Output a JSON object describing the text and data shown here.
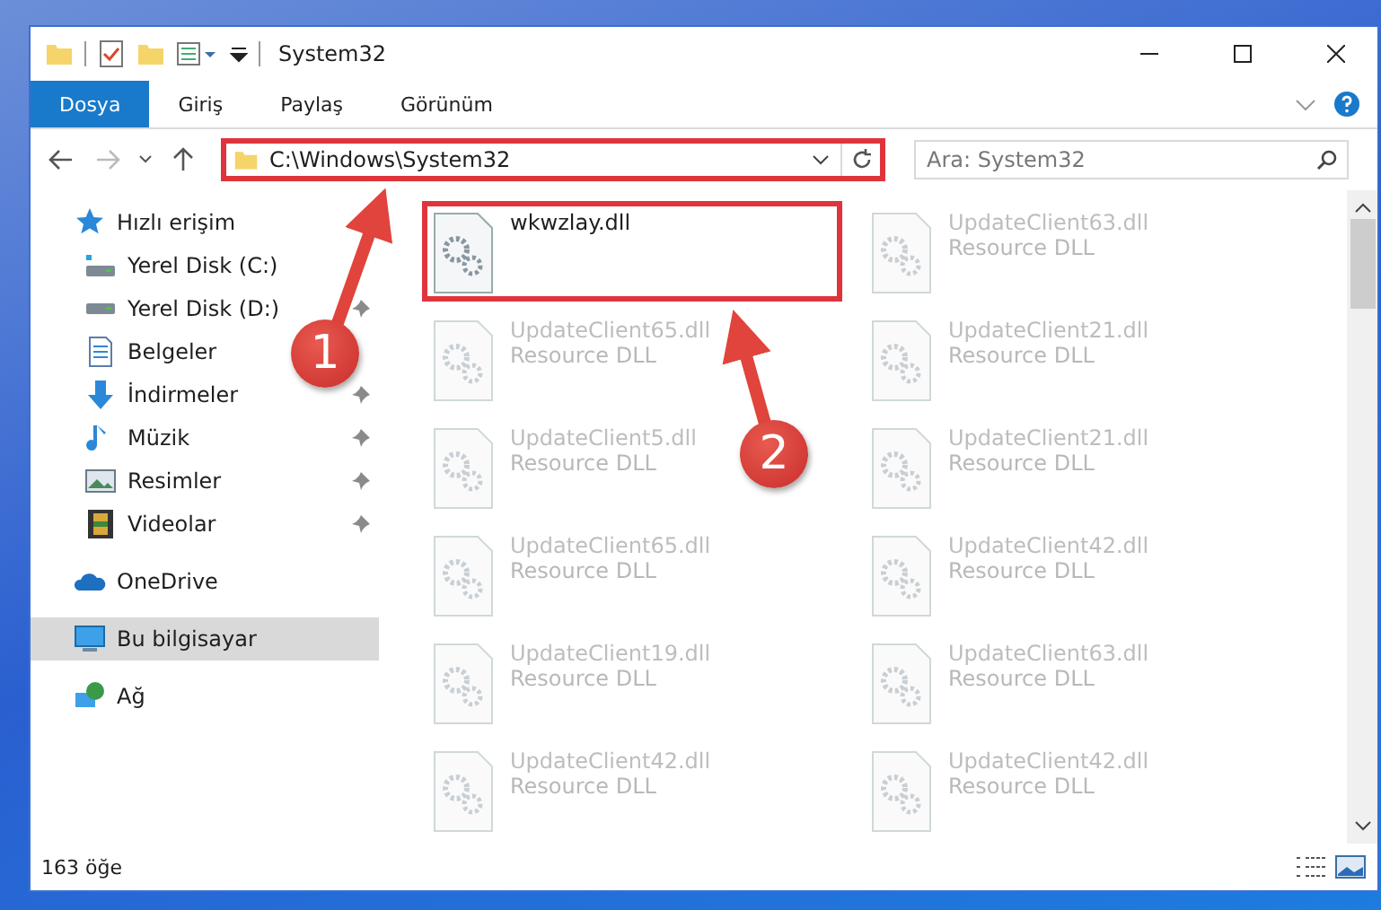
{
  "window": {
    "title": "System32"
  },
  "ribbon_tabs": [
    {
      "label": "Dosya",
      "selected": true
    },
    {
      "label": "Giriş",
      "selected": false
    },
    {
      "label": "Paylaş",
      "selected": false
    },
    {
      "label": "Görünüm",
      "selected": false
    }
  ],
  "address": {
    "path": "C:\\Windows\\System32",
    "highlighted": true
  },
  "search": {
    "placeholder": "Ara: System32"
  },
  "sidebar": {
    "items": [
      {
        "label": "Hızlı erişim",
        "kind": "star",
        "selected": false,
        "children": [
          {
            "label": "Yerel Disk (C:)",
            "kind": "drive-c",
            "pinned": false,
            "selected": false
          },
          {
            "label": "Yerel Disk (D:)",
            "kind": "drive",
            "pinned": true,
            "selected": false
          },
          {
            "label": "Belgeler",
            "kind": "documents",
            "pinned": false,
            "selected": false
          },
          {
            "label": "İndirmeler",
            "kind": "download",
            "pinned": true,
            "selected": false
          },
          {
            "label": "Müzik",
            "kind": "music",
            "pinned": true,
            "selected": false
          },
          {
            "label": "Resimler",
            "kind": "pictures",
            "pinned": true,
            "selected": false
          },
          {
            "label": "Videolar",
            "kind": "videos",
            "pinned": true,
            "selected": false
          }
        ]
      },
      {
        "label": "OneDrive",
        "kind": "cloud",
        "selected": false
      },
      {
        "label": "Bu bilgisayar",
        "kind": "computer",
        "selected": true
      },
      {
        "label": "Ağ",
        "kind": "network",
        "selected": false
      }
    ]
  },
  "files": [
    {
      "name": "wkwzlay.dll",
      "highlighted": true,
      "faded": false
    },
    {
      "name": "UpdateClient63.dll",
      "type": "Resource DLL",
      "highlighted": false,
      "faded": true
    },
    {
      "name": "UpdateClient65.dll",
      "type": "Resource DLL",
      "highlighted": false,
      "faded": true
    },
    {
      "name": "UpdateClient21.dll",
      "type": "Resource DLL",
      "highlighted": false,
      "faded": true
    },
    {
      "name": "UpdateClient5.dll",
      "type": "Resource DLL",
      "highlighted": false,
      "faded": true
    },
    {
      "name": "UpdateClient21.dll",
      "type": "Resource DLL",
      "highlighted": false,
      "faded": true
    },
    {
      "name": "UpdateClient65.dll",
      "type": "Resource DLL",
      "highlighted": false,
      "faded": true
    },
    {
      "name": "UpdateClient42.dll",
      "type": "Resource DLL",
      "highlighted": false,
      "faded": true
    },
    {
      "name": "UpdateClient19.dll",
      "type": "Resource DLL",
      "highlighted": false,
      "faded": true
    },
    {
      "name": "UpdateClient63.dll",
      "type": "Resource DLL",
      "highlighted": false,
      "faded": true
    },
    {
      "name": "UpdateClient42.dll",
      "type": "Resource DLL",
      "highlighted": false,
      "faded": true
    },
    {
      "name": "UpdateClient42.dll",
      "type": "Resource DLL",
      "highlighted": false,
      "faded": true
    }
  ],
  "status_bar": {
    "count": "163 öğe"
  },
  "annotations": [
    {
      "label": "1"
    },
    {
      "label": "2"
    }
  ]
}
